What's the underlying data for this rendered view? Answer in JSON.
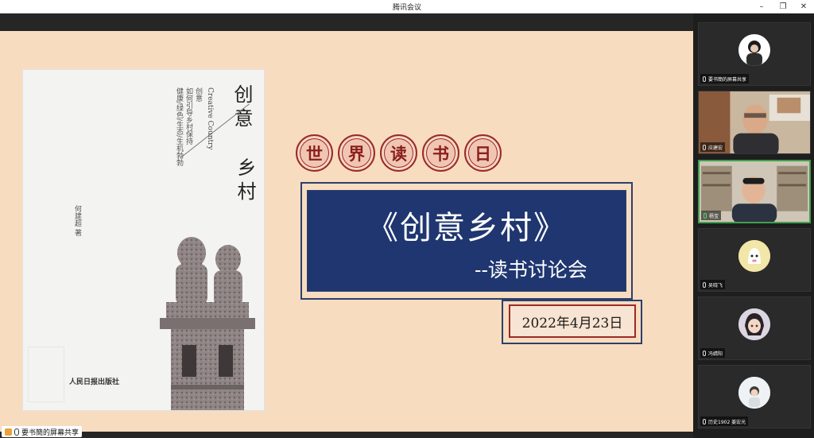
{
  "window": {
    "title": "腾讯会议",
    "controls": {
      "min": "–",
      "max": "❐",
      "close": "✕"
    }
  },
  "slide": {
    "badges": [
      "世",
      "界",
      "读",
      "书",
      "日"
    ],
    "book_title": "《创意乡村》",
    "subtitle": "--读书讨论会",
    "date": "2022年4月23日"
  },
  "book_cover": {
    "title_main": "创意",
    "title_sub": "乡村",
    "english_title": "Creative Country",
    "desc_lines": [
      "创意",
      "如何引导乡村保持",
      "健康/绿色/生态/生机勃勃"
    ],
    "author": "何建超 著",
    "publisher": "人民日报出版社"
  },
  "share_bar": {
    "text": "要书簡的屏幕共享"
  },
  "participants": [
    {
      "name": "要书簡的屏幕共享",
      "type": "avatar",
      "active": false
    },
    {
      "name": "应建宏",
      "type": "video",
      "active": false
    },
    {
      "name": "杨宝",
      "type": "video",
      "active": true
    },
    {
      "name": "吴晓飞",
      "type": "avatar",
      "active": false
    },
    {
      "name": "冯婧阳",
      "type": "avatar",
      "active": false
    },
    {
      "name": "历史1902 姜宏光",
      "type": "avatar",
      "active": false
    }
  ],
  "colors": {
    "slide_bg": "#f8dcbf",
    "navy": "#1f3670",
    "crimson": "#9b2a26",
    "speaking_border": "#3fa14a"
  }
}
